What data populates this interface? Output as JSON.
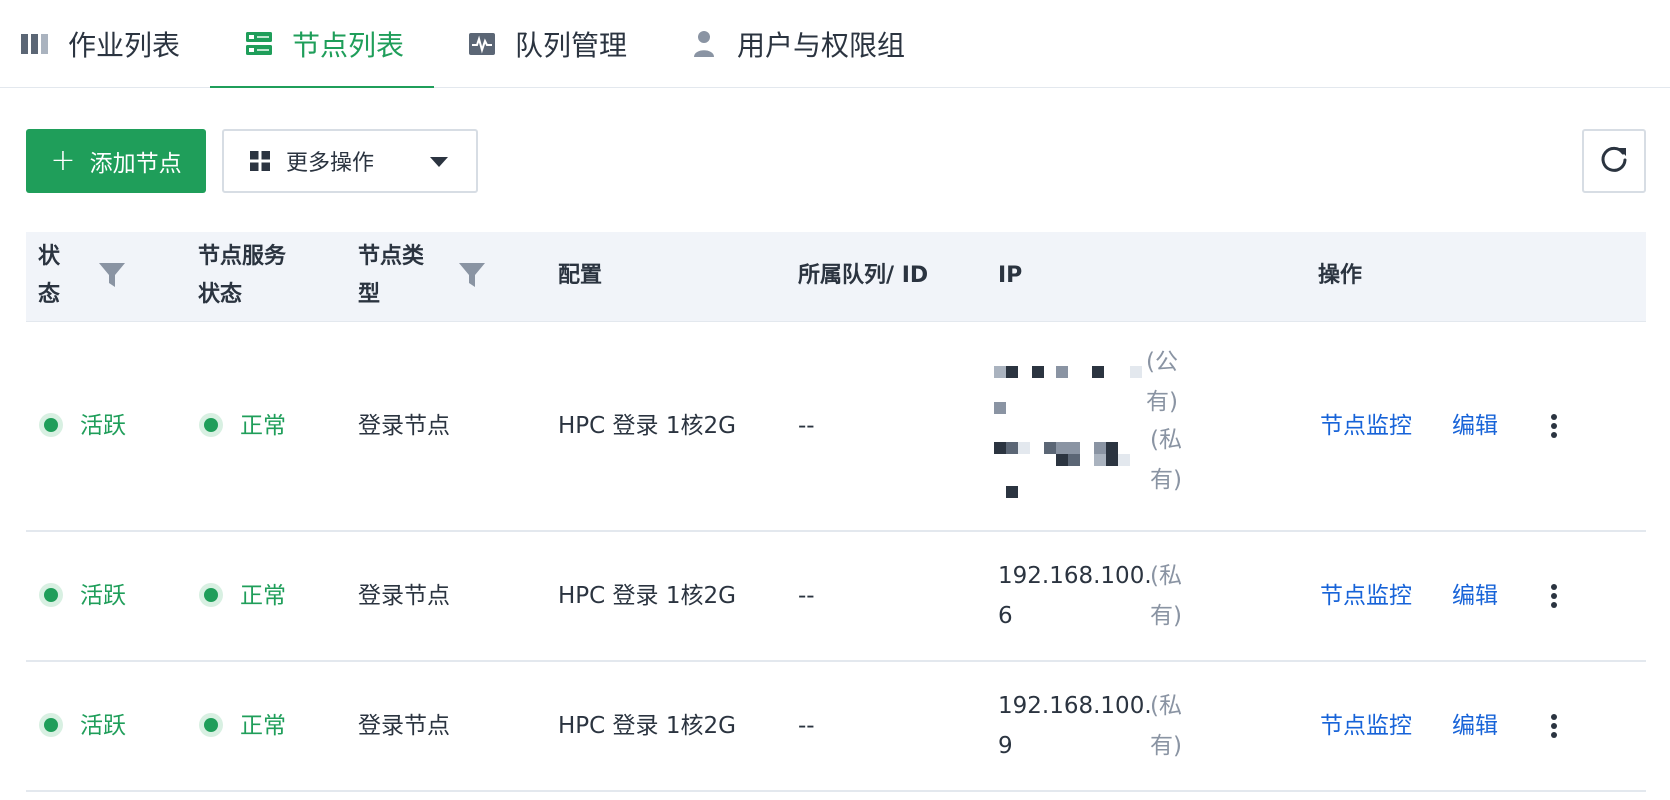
{
  "tabs": [
    {
      "label": "作业列表",
      "icon": "job-list-icon",
      "active": false
    },
    {
      "label": "节点列表",
      "icon": "server-icon",
      "active": true
    },
    {
      "label": "队列管理",
      "icon": "queue-monitor-icon",
      "active": false
    },
    {
      "label": "用户与权限组",
      "icon": "user-icon",
      "active": false
    }
  ],
  "toolbar": {
    "add_label": "添加节点",
    "more_label": "更多操作",
    "refresh_icon": "refresh-icon"
  },
  "table": {
    "headers": {
      "status_line1": "状",
      "status_line2": "态",
      "service_line1": "节点服务",
      "service_line2": "状态",
      "type_line1": "节点类",
      "type_line2": "型",
      "config": "配置",
      "queue": "所属队列/ ID",
      "ip": "IP",
      "actions": "操作"
    },
    "rows": [
      {
        "status": "活跃",
        "service": "正常",
        "type": "登录节点",
        "config": "HPC 登录 1核2G",
        "queue": "--",
        "ip_public_tag_1": "(公",
        "ip_public_tag_2": "有)",
        "ip_private_tag_1": "(私",
        "ip_private_tag_2": "有)",
        "monitor": "节点监控",
        "edit": "编辑"
      },
      {
        "status": "活跃",
        "service": "正常",
        "type": "登录节点",
        "config": "HPC 登录 1核2G",
        "queue": "--",
        "ip_line1": "192.168.100.",
        "ip_line2": "6",
        "ip_tag_1": "(私",
        "ip_tag_2": "有)",
        "monitor": "节点监控",
        "edit": "编辑"
      },
      {
        "status": "活跃",
        "service": "正常",
        "type": "登录节点",
        "config": "HPC 登录 1核2G",
        "queue": "--",
        "ip_line1": "192.168.100.",
        "ip_line2": "9",
        "ip_tag_1": "(私",
        "ip_tag_2": "有)",
        "monitor": "节点监控",
        "edit": "编辑"
      }
    ]
  },
  "colors": {
    "accent": "#1f9e5a",
    "link": "#1763d8",
    "header_bg": "#f1f4f9"
  }
}
